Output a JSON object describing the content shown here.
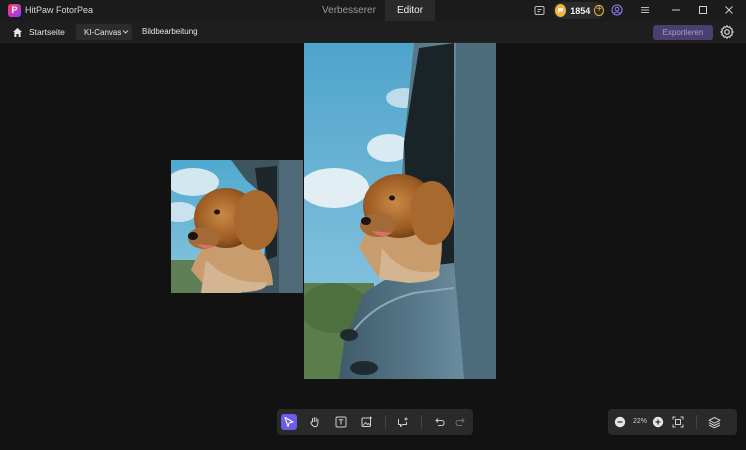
{
  "app": {
    "name": "HitPaw FotorPea",
    "logo_letter": "P"
  },
  "mode_tabs": [
    {
      "label": "Verbesserer",
      "active": false
    },
    {
      "label": "Editor",
      "active": true
    }
  ],
  "titlebar": {
    "credits": "1854",
    "add_symbol": "+"
  },
  "navbar": {
    "home_label": "Startseite",
    "ki_canvas_label": "KI-Canvas",
    "bild_label": "Bildbearbeitung",
    "export_label": "Exportieren"
  },
  "canvas": {
    "images": [
      {
        "name": "small-photo",
        "subject": "dog-in-car-window"
      },
      {
        "name": "large-photo",
        "subject": "dog-in-car-window"
      }
    ]
  },
  "tools": [
    {
      "name": "select-tool",
      "icon": "cursor-icon",
      "active": true
    },
    {
      "name": "hand-tool",
      "icon": "hand-icon",
      "active": false
    },
    {
      "name": "text-tool",
      "icon": "text-icon",
      "active": false
    },
    {
      "name": "add-image-tool",
      "icon": "image-plus-icon",
      "active": false
    },
    {
      "name": "ai-chat-tool",
      "icon": "sparkle-chat-icon",
      "active": false
    },
    {
      "name": "undo-button",
      "icon": "undo-icon",
      "active": false
    },
    {
      "name": "redo-button",
      "icon": "redo-icon",
      "active": false
    }
  ],
  "zoom": {
    "value": "22%"
  },
  "colors": {
    "accent": "#6c5ce7",
    "coin": "#f6b33a",
    "export_bg": "#4b3f72",
    "background": "#121212"
  }
}
